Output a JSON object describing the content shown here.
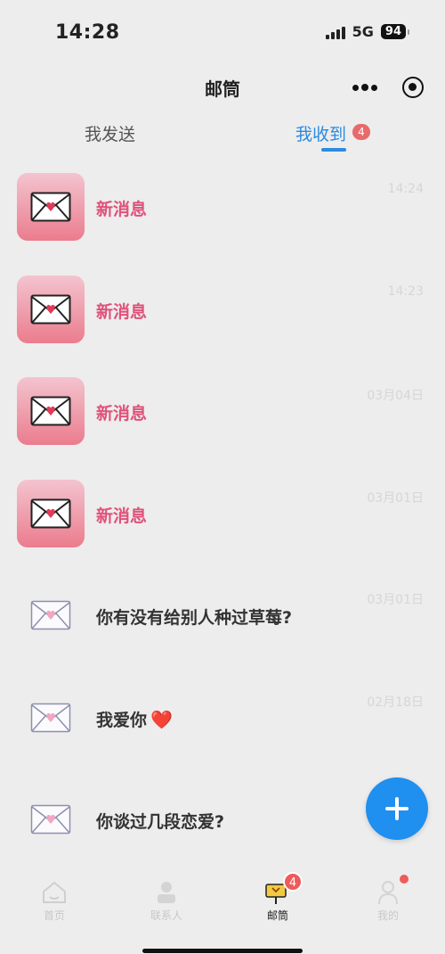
{
  "status": {
    "time": "14:28",
    "network": "5G",
    "battery": "94"
  },
  "nav": {
    "title": "邮筒"
  },
  "tabs": {
    "sent": "我发送",
    "received": "我收到",
    "received_badge": "4",
    "active": "received"
  },
  "messages": [
    {
      "text": "新消息",
      "time": "14:24",
      "unread": true
    },
    {
      "text": "新消息",
      "time": "14:23",
      "unread": true
    },
    {
      "text": "新消息",
      "time": "03月04日",
      "unread": true
    },
    {
      "text": "新消息",
      "time": "03月01日",
      "unread": true
    },
    {
      "text": "你有没有给别人种过草莓?",
      "time": "03月01日",
      "unread": false
    },
    {
      "text": "我爱你",
      "emoji": "❤️",
      "time": "02月18日",
      "unread": false
    },
    {
      "text": "你谈过几段恋爱?",
      "time": "",
      "unread": false
    }
  ],
  "tabbar": {
    "items": [
      {
        "label": "首页",
        "icon": "home-icon"
      },
      {
        "label": "联系人",
        "icon": "contacts-icon"
      },
      {
        "label": "邮筒",
        "icon": "mailbox-icon",
        "active": true
      },
      {
        "label": "我的",
        "icon": "profile-icon"
      }
    ],
    "mailbox_badge": "4"
  },
  "colors": {
    "accent": "#2a8be0",
    "fab": "#1f8ff0",
    "new_message": "#e0517a",
    "badge": "#ef5a5a"
  }
}
